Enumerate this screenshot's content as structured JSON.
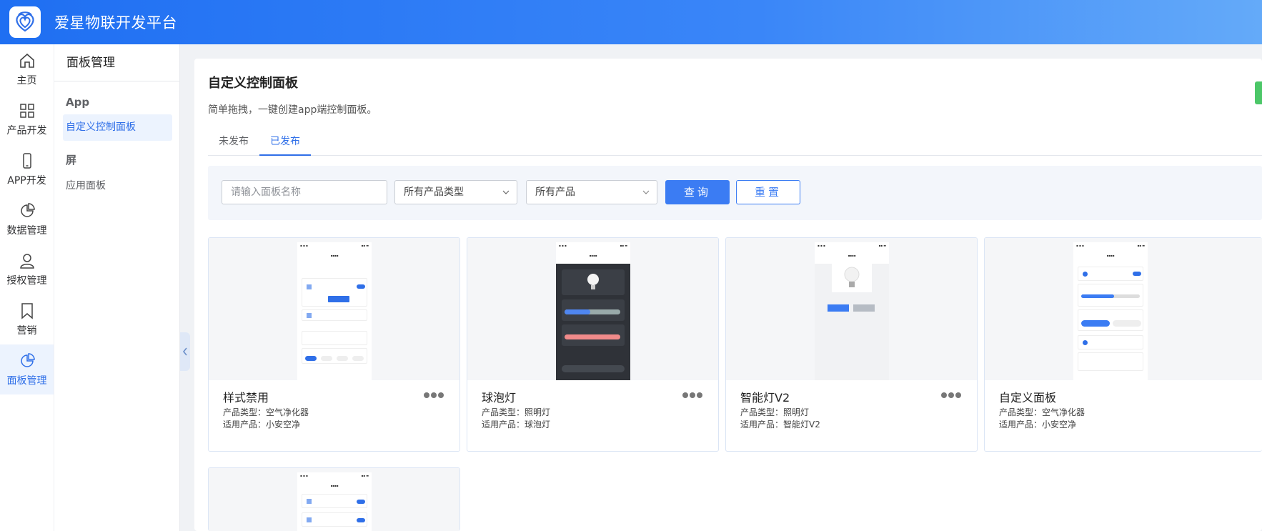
{
  "app": {
    "title": "爱星物联开发平台"
  },
  "leftnav": [
    {
      "label": "主页",
      "icon": "home-icon"
    },
    {
      "label": "产品开发",
      "icon": "grid-icon"
    },
    {
      "label": "APP开发",
      "icon": "phone-icon"
    },
    {
      "label": "数据管理",
      "icon": "pie-chart-icon"
    },
    {
      "label": "授权管理",
      "icon": "user-icon"
    },
    {
      "label": "营销",
      "icon": "bookmark-icon"
    },
    {
      "label": "面板管理",
      "icon": "pie-chart-icon",
      "active": true
    }
  ],
  "subnav": {
    "title": "面板管理",
    "groups": [
      {
        "label": "App",
        "items": [
          {
            "label": "自定义控制面板",
            "active": true
          }
        ]
      },
      {
        "label": "屏",
        "items": [
          {
            "label": "应用面板"
          }
        ]
      }
    ]
  },
  "page": {
    "title": "自定义控制面板",
    "description": "简单拖拽，一键创建app端控制面板。",
    "tabs": [
      {
        "label": "未发布"
      },
      {
        "label": "已发布",
        "active": true
      }
    ]
  },
  "filters": {
    "name_placeholder": "请输入面板名称",
    "product_type_value": "所有产品类型",
    "product_value": "所有产品",
    "query_label": "查询",
    "reset_label": "重置"
  },
  "cards": [
    {
      "name": "样式禁用",
      "type_label": "产品类型：",
      "type_value": "空气净化器",
      "product_label": "适用产品：",
      "product_value": "小安空净"
    },
    {
      "name": "球泡灯",
      "type_label": "产品类型：",
      "type_value": "照明灯",
      "product_label": "适用产品：",
      "product_value": "球泡灯"
    },
    {
      "name": "智能灯V2",
      "type_label": "产品类型：",
      "type_value": "照明灯",
      "product_label": "适用产品：",
      "product_value": "智能灯V2"
    },
    {
      "name": "自定义面板",
      "type_label": "产品类型：",
      "type_value": "空气净化器",
      "product_label": "适用产品：",
      "product_value": "小安空净"
    }
  ],
  "colors": {
    "primary": "#3b7cf3",
    "header_start": "#1f6ff2",
    "header_end": "#64aaf9",
    "accent_green": "#4cc768"
  }
}
